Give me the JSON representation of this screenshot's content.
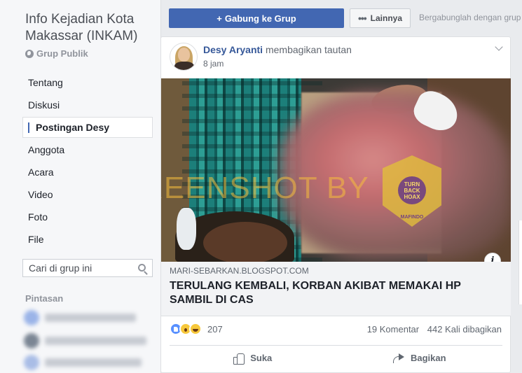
{
  "group": {
    "title": "Info Kejadian Kota Makassar (INKAM)",
    "type": "Grup Publik"
  },
  "nav": {
    "items": [
      {
        "label": "Tentang"
      },
      {
        "label": "Diskusi"
      },
      {
        "label": "Postingan Desy",
        "active": true
      },
      {
        "label": "Anggota"
      },
      {
        "label": "Acara"
      },
      {
        "label": "Video"
      },
      {
        "label": "Foto"
      },
      {
        "label": "File"
      }
    ]
  },
  "search": {
    "placeholder": "Cari di grup ini"
  },
  "shortcuts": {
    "title": "Pintasan"
  },
  "toolbar": {
    "join_label": "Gabung ke Grup",
    "join_icon": "plus-icon",
    "more_label": "Lainnya",
    "more_icon": "dots-icon",
    "hint": "Bergabunglah dengan grup"
  },
  "post": {
    "author": "Desy Aryanti",
    "action": "membagikan tautan",
    "time": "8 jam",
    "image": {
      "watermark": "SCREENSHOT BY",
      "badge_center": "TURN BACK HOAX",
      "badge_label": "MAFINDO"
    },
    "link": {
      "domain": "MARI-SEBARKAN.BLOGSPOT.COM",
      "title": "TERULANG KEMBALI, KORBAN AKIBAT MEMAKAI HP SAMBIL DI CAS"
    },
    "reactions": {
      "icons": [
        "like-icon",
        "wow-icon",
        "haha-icon"
      ],
      "count": "207"
    },
    "comments": "19 Komentar",
    "shares": "442 Kali dibagikan",
    "actions": {
      "like_label": "Suka",
      "share_label": "Bagikan"
    }
  },
  "colors": {
    "accent": "#4267b2",
    "link": "#365899",
    "sidebar_bg": "#f6f7f9",
    "page_bg": "#e9ebee"
  }
}
